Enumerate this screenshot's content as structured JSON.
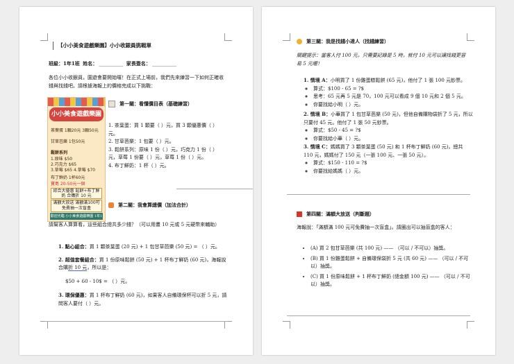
{
  "page1": {
    "title": "【小小美食遊戲樂園】小小收銀員挑戰單",
    "class_label": "班級：1年1班",
    "name_label": "姓名：",
    "parent_label": "家長簽名：",
    "blank": "__________",
    "intro": "各位小小收銀員，園遊會要開始囉！在正式上場前，我們先來練習一下如何正確收錢與找錢吧。請根據海報上的價格完成以下挑戰：",
    "poster": {
      "title": "小小美食遊戲樂園",
      "item1": "茶葉蛋 1顆20元 3顆50元",
      "item2": "甘草芭樂 1包50元",
      "item3": "鬆餅系列",
      "item3a": "1.原味 $50",
      "item3b": "2.巧克力 $65",
      "item3c": "3.草莓 $65  4.草莓 $70",
      "item4": "布丁鮮奶 1杯60元",
      "item5": "寶島 20-50元一個",
      "combo": "綜合大優惠 鬆餅+布丁鮮奶 合購折 10 元",
      "bonus": "滿額大放送 滿額滿100可免費抽一次盲盒",
      "footer": "歡迎光臨 小小美食遊戲樂園 1年1班"
    },
    "section1": {
      "title": "第一關：看懂價目表",
      "subtitle": "（基礎練習）",
      "items": [
        "1. 茶葉蛋：買 1 顆要（  ）元，買 3 顆優惠價（  ）元。",
        "2. 甘草芭樂：1 包要（  ）元。",
        "3. 鬆餅系列：原味 1 份（  ）元，巧克力 1 份（  ）元，草莓 1 份要（  ）元，草莓 1 份（  ）元。",
        "4. 布丁鮮奶：1 杯（  ）元。"
      ]
    },
    "section2": {
      "title": "第二關：我會算總價",
      "subtitle": "（加法合計）",
      "intro": "請幫客人算算看，這些組合總共多少錢？（可以用畫 10 元或 5 元硬幣來輔助）",
      "items": [
        {
          "label": "1. 點心組合：",
          "text": "買 1 顆茶葉蛋 (20 元) + 1 包甘草芭樂 (50 元) = （  ）元。"
        },
        {
          "label": "2. 超值套餐組合：",
          "text": "買 1 份原味鬆餅 (50 元) + 1 杯布丁鮮奶 (60 元)，海報說合購",
          "link": "折 10 元",
          "tail": "，所以是："
        },
        {
          "label": "",
          "text": "$50 + 60 - 10$ = （  ）元。"
        },
        {
          "label": "3. 環保優惠：",
          "text": "買 1 杯布丁鮮奶 (60 元)，如果客人自備環保杯可以折 5 元，請問客人要付（  ）元。"
        }
      ]
    }
  },
  "page2": {
    "section3": {
      "title": "第三關：我是找錢小達人",
      "subtitle": "（找錢練習）",
      "hint": "關鍵提示：當客人付 100 元，只需要記錄是 5 時，就付 10 元可以讓找錢更容易 5 元喔！",
      "items": [
        {
          "label": "1. 情境 A：",
          "text": "小明買了 1 份雞蛋糕鬆餅 (65 元)，他付了 1 張 100 元鈔票。",
          "formula": "算式：$100 - 65 = ?$",
          "think": "思考：65 元再 5 元是 70，100 元可以看成 9 個 10 元和 2 個 5 元。",
          "answer": "你要找給小明（  ）元。"
        },
        {
          "label": "2. 情境 B：",
          "text": "小華買了 1 包甘草芭樂 (50 元)，但他自備購物袋折了 5 元，所以只要付 45 元。他付了 1 張 50 元鈔票。",
          "formula": "算式：$50 - 45 = ?$",
          "answer": "你要找給小華（  ）元。"
        },
        {
          "label": "3. 情境 C：",
          "text": "媽媽買了 3 顆茶葉蛋 (50 元) 和 1 杯布丁鮮奶 (60 元)，總共 110 元，媽媽付了 150 元（一張 100 元、一張 50 元）。",
          "formula": "算式：$150 - 110 = ?$",
          "answer": "你要找給媽媽（  ）元。"
        }
      ]
    },
    "section4": {
      "title": "第四關：滿額大放送",
      "subtitle": "（判斷題）",
      "intro": "海報說：「滿額滿 100 元可免費抽一次盲盒」。請圈出可以抽盲盒的客人：",
      "items": [
        "(A) 買 2 包甘草芭樂 (共 100 元) —— （可以 / 不可以）抽獎。",
        "(B) 買 1 份雞蛋鬆餅 + 自備環保袋折 5 元 (共 60 元) —— （可以 / 不可以）抽獎。",
        "(C) 買 1 份原味鬆餅 + 1 杯布丁鮮奶 (總金額 100 元) —— （可以 / 不可以）抽獎。"
      ]
    }
  }
}
